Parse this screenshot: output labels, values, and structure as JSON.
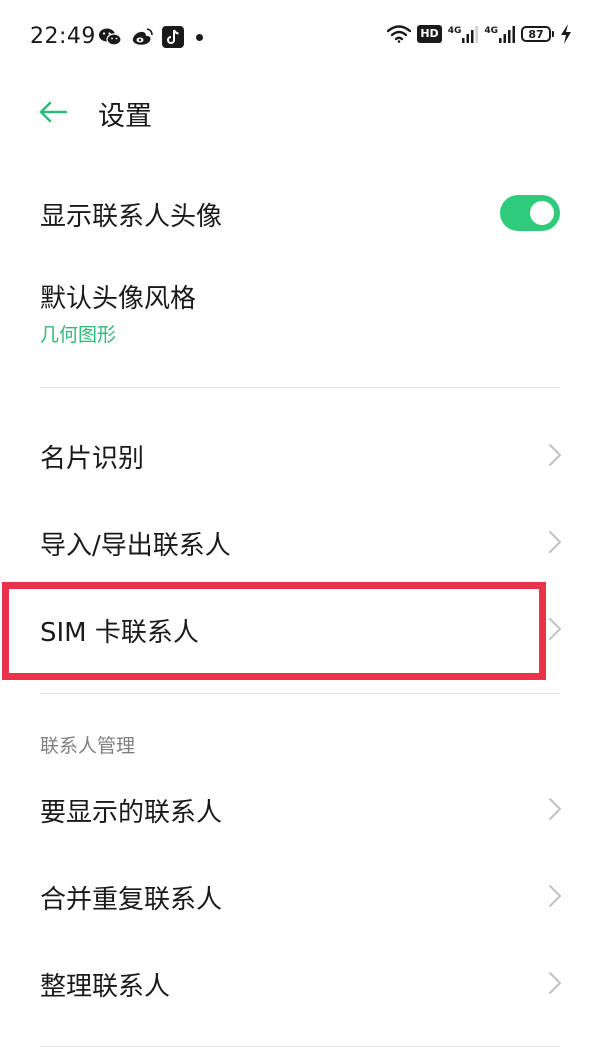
{
  "status_bar": {
    "time": "22:49",
    "network_label_1": "4G",
    "network_label_2": "4G",
    "hd_label": "HD",
    "battery_level": "87"
  },
  "header": {
    "title": "设置"
  },
  "rows": {
    "show_avatar": {
      "label": "显示联系人头像",
      "toggle_on": true
    },
    "default_avatar_style": {
      "label": "默认头像风格",
      "value": "几何图形"
    },
    "business_card": {
      "label": "名片识别"
    },
    "import_export": {
      "label": "导入/导出联系人"
    },
    "sim_contacts": {
      "label": "SIM 卡联系人"
    }
  },
  "contact_management": {
    "section_title": "联系人管理",
    "contacts_to_display": {
      "label": "要显示的联系人"
    },
    "merge_duplicates": {
      "label": "合并重复联系人"
    },
    "organize_contacts": {
      "label": "整理联系人"
    }
  },
  "colors": {
    "accent": "#2fcb7d",
    "accent_text": "#2fbb78",
    "highlight": "#e8344b"
  },
  "icons": {
    "back": "arrow-left-icon",
    "chevron": "chevron-right-icon",
    "wechat": "wechat-icon",
    "weibo": "weibo-icon",
    "tiktok": "tiktok-icon",
    "wifi": "wifi-icon",
    "signal": "signal-bars-icon",
    "battery": "battery-icon",
    "charging": "lightning-icon"
  }
}
